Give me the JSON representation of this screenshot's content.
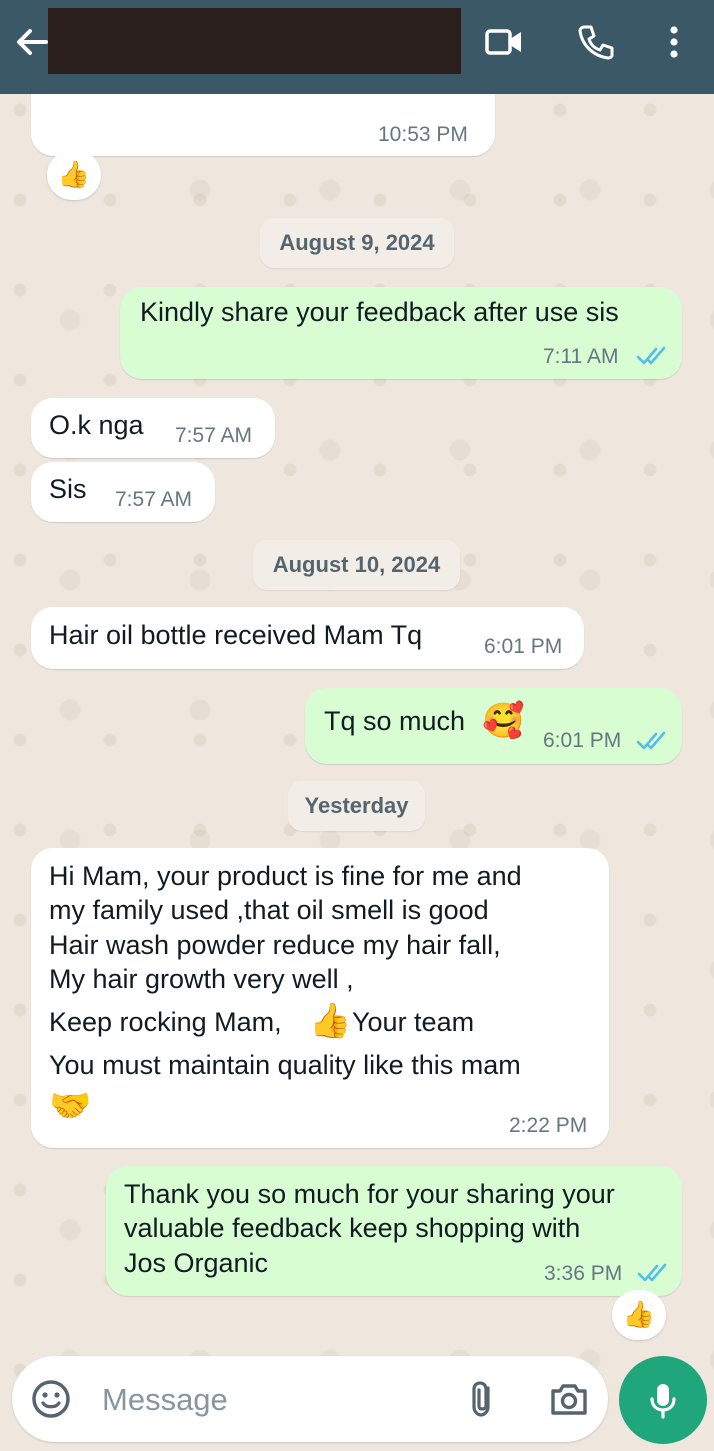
{
  "header": {
    "contact_name": "",
    "icons": [
      "back-arrow-icon",
      "video-call-icon",
      "voice-call-icon",
      "more-options-icon"
    ]
  },
  "messages": [
    {
      "dir": "in",
      "text": "",
      "time": "10:53 PM",
      "reaction": "👍"
    },
    {
      "date": "August 9, 2024"
    },
    {
      "dir": "out",
      "text": "Kindly share your feedback after use sis",
      "time": "7:11 AM",
      "read": true
    },
    {
      "dir": "in",
      "text": "O.k nga",
      "time": "7:57 AM"
    },
    {
      "dir": "in",
      "text": "Sis",
      "time": "7:57 AM"
    },
    {
      "date": "August 10, 2024"
    },
    {
      "dir": "in",
      "text": "Hair oil bottle received Mam Tq",
      "time": "6:01 PM"
    },
    {
      "dir": "out",
      "text": "Tq so much",
      "emoji": "🥰",
      "time": "6:01 PM",
      "read": true
    },
    {
      "date": "Yesterday"
    },
    {
      "dir": "in",
      "lines": [
        "Hi Mam, your product is fine for me and",
        "my family used ,that oil smell is good",
        "Hair wash powder reduce my hair fall,",
        "My hair growth very well ,",
        "Keep rocking Mam,",
        "Your team",
        "You must maintain quality like this mam"
      ],
      "emoji_inline": "👍",
      "emoji_end": "🤝",
      "time": "2:22 PM"
    },
    {
      "dir": "out",
      "lines": [
        "Thank you so much for your sharing your",
        "valuable feedback keep shopping with",
        "Jos Organic"
      ],
      "time": "3:36 PM",
      "read": true,
      "reaction": "👍"
    }
  ],
  "composer": {
    "placeholder": "Message",
    "icons": [
      "emoji-icon",
      "attach-icon",
      "camera-icon",
      "mic-icon"
    ]
  },
  "colors": {
    "header": "#3b5866",
    "incoming_bubble": "#ffffff",
    "outgoing_bubble": "#d9fdd3",
    "read_ticks": "#53bdeb",
    "mic_button": "#1fa67a",
    "wallpaper": "#efe7de"
  }
}
